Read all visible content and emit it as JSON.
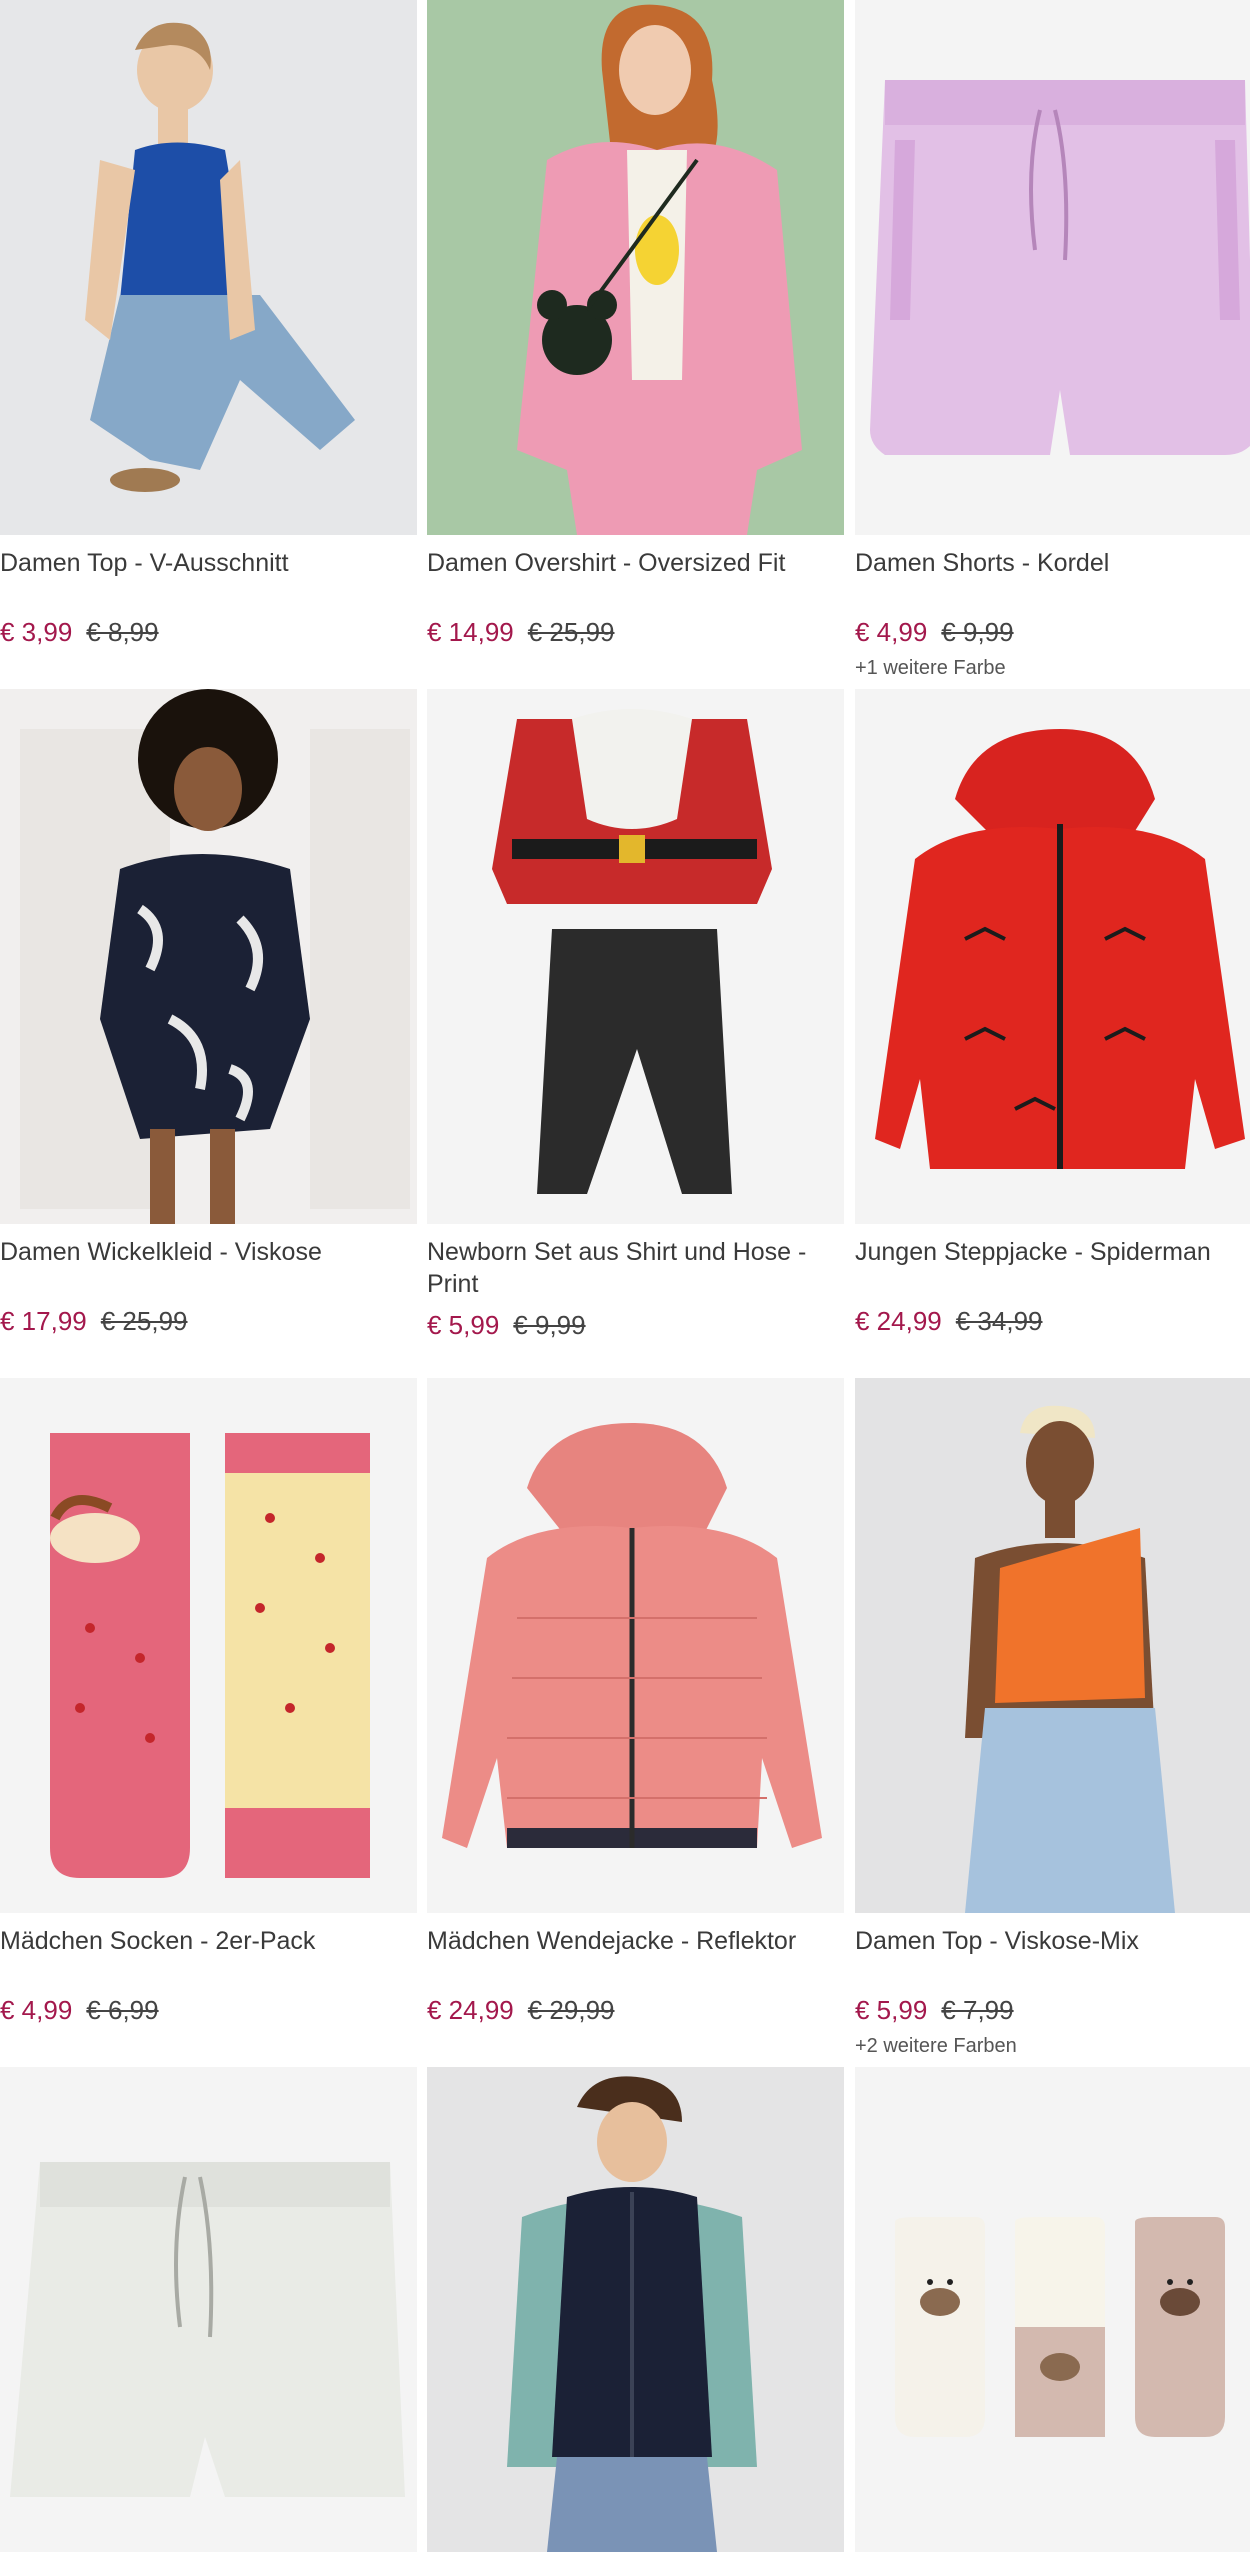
{
  "products": [
    {
      "title": "Damen Top - V-Ausschnitt",
      "price": "€ 3,99",
      "old_price": "€ 8,99",
      "more": "",
      "image": "woman-blue-top-photo"
    },
    {
      "title": "Damen Overshirt - Oversized Fit",
      "price": "€ 14,99",
      "old_price": "€ 25,99",
      "more": "",
      "image": "woman-pink-overshirt-photo"
    },
    {
      "title": "Damen Shorts - Kordel",
      "price": "€ 4,99",
      "old_price": "€ 9,99",
      "more": "+1 weitere Farbe",
      "image": "lilac-shorts-photo"
    },
    {
      "title": "Damen Wickelkleid - Viskose",
      "price": "€ 17,99",
      "old_price": "€ 25,99",
      "more": "",
      "image": "woman-floral-dress-photo"
    },
    {
      "title": "Newborn Set aus Shirt und Hose - Print",
      "price": "€ 5,99",
      "old_price": "€ 9,99",
      "more": "",
      "image": "santa-baby-set-photo"
    },
    {
      "title": "Jungen Steppjacke - Spiderman",
      "price": "€ 24,99",
      "old_price": "€ 34,99",
      "more": "",
      "image": "red-spiderman-jacket-photo"
    },
    {
      "title": "Mädchen Socken - 2er-Pack",
      "price": "€ 4,99",
      "old_price": "€ 6,99",
      "more": "",
      "image": "unicorn-socks-photo"
    },
    {
      "title": "Mädchen Wendejacke - Reflektor",
      "price": "€ 24,99",
      "old_price": "€ 29,99",
      "more": "",
      "image": "pink-puffer-jacket-photo"
    },
    {
      "title": "Damen Top - Viskose-Mix",
      "price": "€ 5,99",
      "old_price": "€ 7,99",
      "more": "+2 weitere Farben",
      "image": "woman-orange-top-photo"
    },
    {
      "title": "",
      "price": "",
      "old_price": "",
      "more": "",
      "image": "white-shorts-photo"
    },
    {
      "title": "",
      "price": "",
      "old_price": "",
      "more": "",
      "image": "man-navy-vest-photo"
    },
    {
      "title": "",
      "price": "",
      "old_price": "",
      "more": "",
      "image": "bear-socks-photo"
    }
  ],
  "colors": {
    "price": "#a3184c",
    "text": "#3a3a3a"
  }
}
